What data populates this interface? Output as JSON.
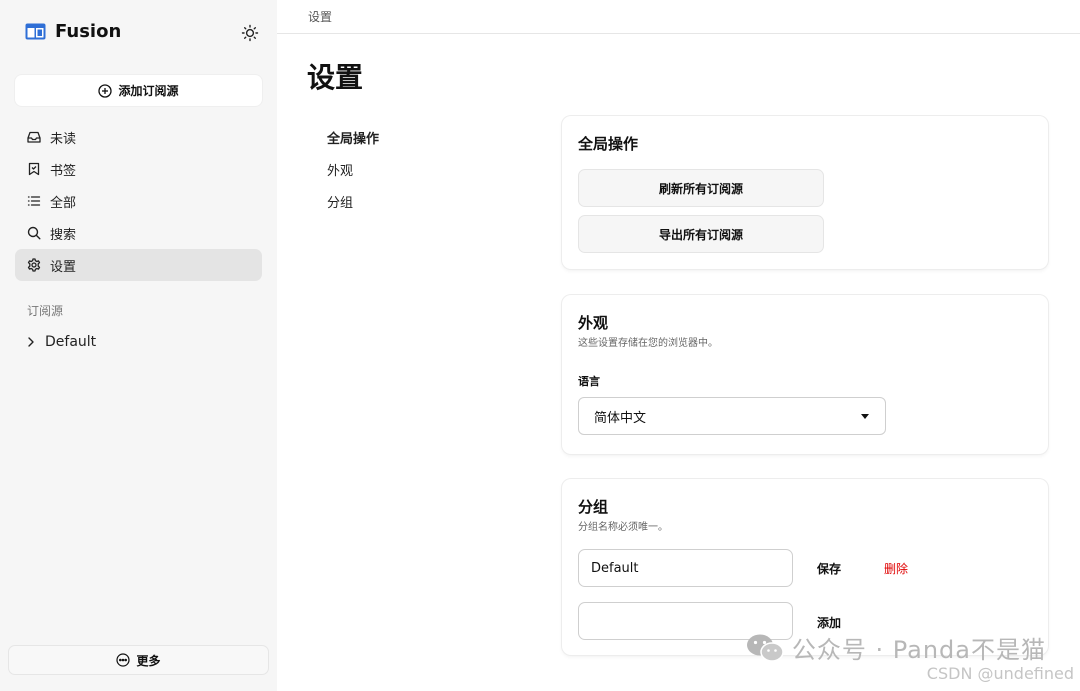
{
  "sidebar": {
    "app_name": "Fusion",
    "add_feed_label": "添加订阅源",
    "nav": [
      {
        "label": "未读",
        "icon": "inbox-icon"
      },
      {
        "label": "书签",
        "icon": "bookmark-icon"
      },
      {
        "label": "全部",
        "icon": "list-icon"
      },
      {
        "label": "搜索",
        "icon": "search-icon"
      },
      {
        "label": "设置",
        "icon": "gear-icon",
        "active": true
      }
    ],
    "feeds_section_label": "订阅源",
    "groups": [
      {
        "label": "Default"
      }
    ],
    "more_label": "更多"
  },
  "header": {
    "breadcrumb": "设置",
    "page_title": "设置"
  },
  "settings_nav": [
    {
      "label": "全局操作",
      "active": true
    },
    {
      "label": "外观"
    },
    {
      "label": "分组"
    }
  ],
  "global_actions": {
    "title": "全局操作",
    "refresh_label": "刷新所有订阅源",
    "export_label": "导出所有订阅源"
  },
  "appearance": {
    "title": "外观",
    "description": "这些设置存储在您的浏览器中。",
    "language_label": "语言",
    "language_value": "简体中文"
  },
  "groups": {
    "title": "分组",
    "description": "分组名称必须唯一。",
    "rows": [
      {
        "value": "Default",
        "save_label": "保存",
        "delete_label": "删除"
      }
    ],
    "new_value": "",
    "add_label": "添加"
  },
  "watermark": {
    "text": "公众号 · Panda不是猫",
    "source": "CSDN @undefined"
  },
  "colors": {
    "sidebar_bg": "#f6f6f6",
    "active_nav_bg": "#e4e4e4",
    "danger": "#e00000"
  }
}
